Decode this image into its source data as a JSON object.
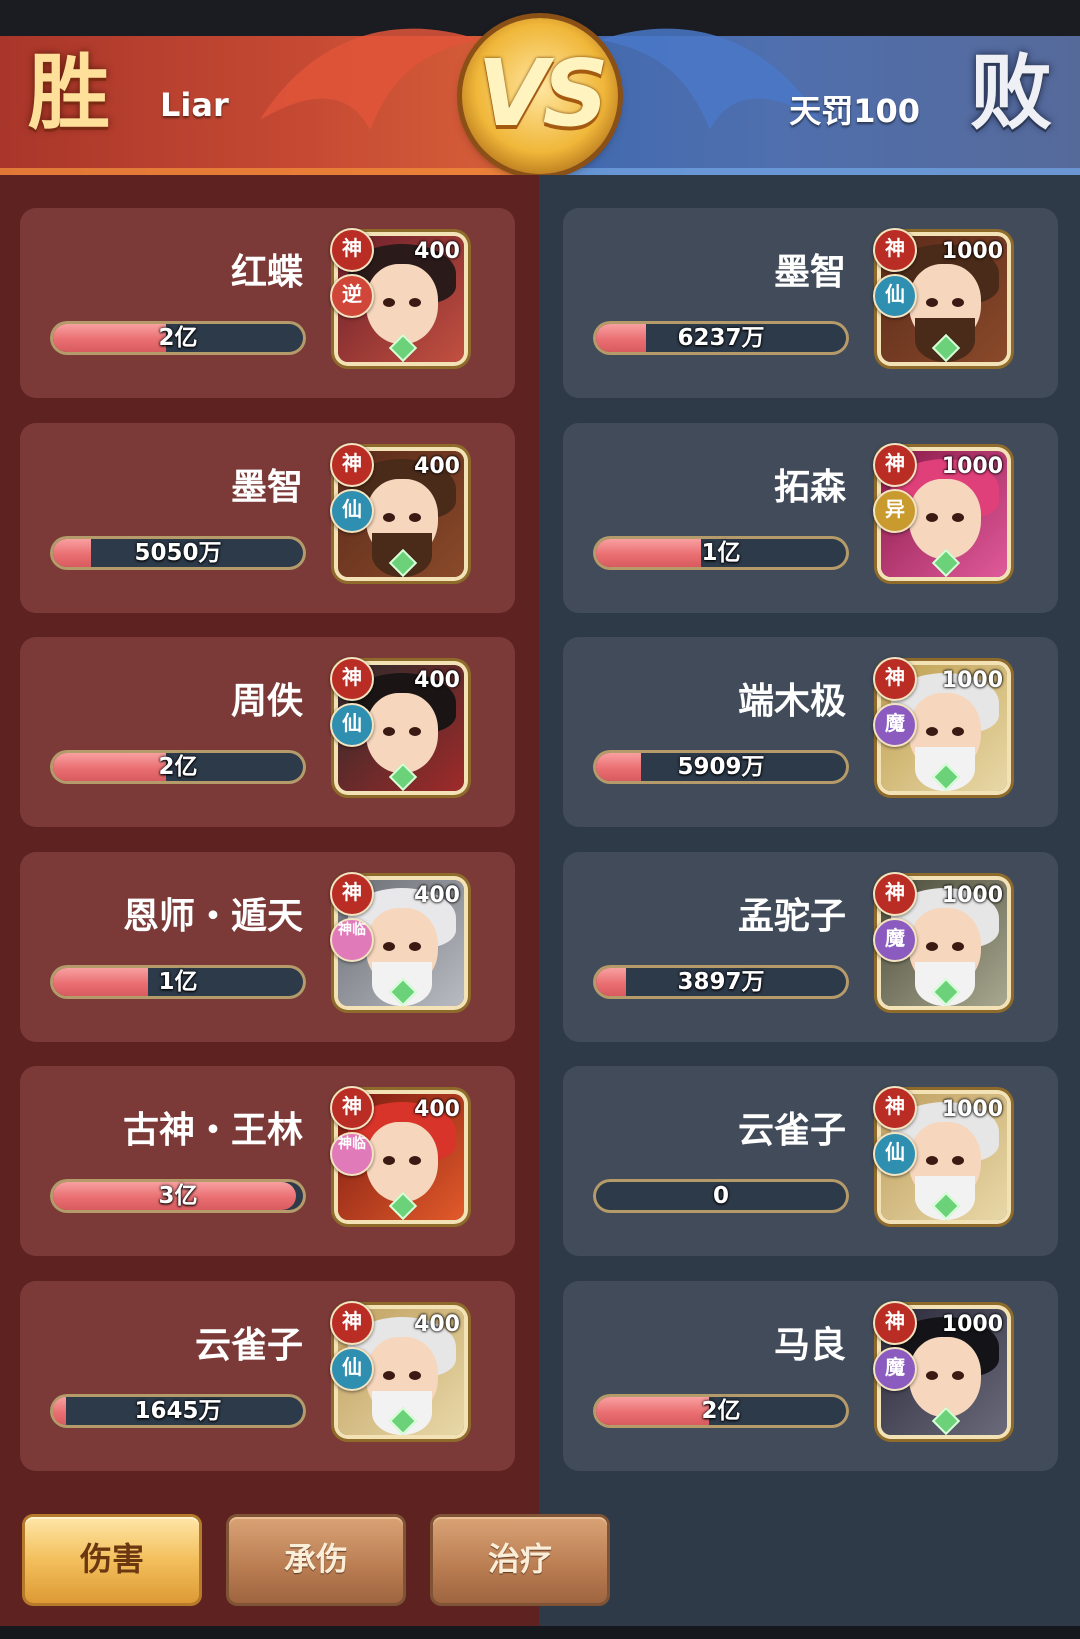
{
  "header": {
    "left_result": "胜",
    "left_player": "Liar",
    "vs": "VS",
    "right_player": "天罚100",
    "right_result": "败"
  },
  "colors": {
    "win_panel": "#5e2220",
    "lose_panel": "#2f3a48",
    "bar_fill": "#ea6f72",
    "tab_active": "#f3bf5c"
  },
  "left_heroes": [
    {
      "name": "红蝶",
      "damage": "2亿",
      "fill": 0.45,
      "star": "400",
      "badge1": "神",
      "badge2": "逆",
      "badge2_color": "#d0473a"
    },
    {
      "name": "墨智",
      "damage": "5050万",
      "fill": 0.15,
      "star": "400",
      "badge1": "神",
      "badge2": "仙",
      "badge2_color": "#2f8fb0"
    },
    {
      "name": "周佚",
      "damage": "2亿",
      "fill": 0.45,
      "star": "400",
      "badge1": "神",
      "badge2": "仙",
      "badge2_color": "#2f8fb0"
    },
    {
      "name": "恩师・遁天",
      "damage": "1亿",
      "fill": 0.38,
      "star": "400",
      "badge1": "神",
      "badge2": "神临",
      "badge2_color": "#e07ab8"
    },
    {
      "name": "古神・王林",
      "damage": "3亿",
      "fill": 0.97,
      "star": "400",
      "badge1": "神",
      "badge2": "神临",
      "badge2_color": "#e07ab8"
    },
    {
      "name": "云雀子",
      "damage": "1645万",
      "fill": 0.05,
      "star": "400",
      "badge1": "神",
      "badge2": "仙",
      "badge2_color": "#2f8fb0"
    }
  ],
  "right_heroes": [
    {
      "name": "墨智",
      "damage": "6237万",
      "fill": 0.2,
      "star": "1000",
      "badge1": "神",
      "badge2": "仙",
      "badge2_color": "#2f8fb0"
    },
    {
      "name": "拓森",
      "damage": "1亿",
      "fill": 0.42,
      "star": "1000",
      "badge1": "神",
      "badge2": "异",
      "badge2_color": "#c99a2e"
    },
    {
      "name": "端木极",
      "damage": "5909万",
      "fill": 0.18,
      "star": "1000",
      "badge1": "神",
      "badge2": "魔",
      "badge2_color": "#8b5bc0"
    },
    {
      "name": "孟驼子",
      "damage": "3897万",
      "fill": 0.12,
      "star": "1000",
      "badge1": "神",
      "badge2": "魔",
      "badge2_color": "#8b5bc0"
    },
    {
      "name": "云雀子",
      "damage": "0",
      "fill": 0.0,
      "star": "1000",
      "badge1": "神",
      "badge2": "仙",
      "badge2_color": "#2f8fb0"
    },
    {
      "name": "马良",
      "damage": "2亿",
      "fill": 0.45,
      "star": "1000",
      "badge1": "神",
      "badge2": "魔",
      "badge2_color": "#8b5bc0"
    }
  ],
  "tabs": [
    {
      "label": "伤害",
      "active": true
    },
    {
      "label": "承伤",
      "active": false
    },
    {
      "label": "治疗",
      "active": false
    }
  ]
}
